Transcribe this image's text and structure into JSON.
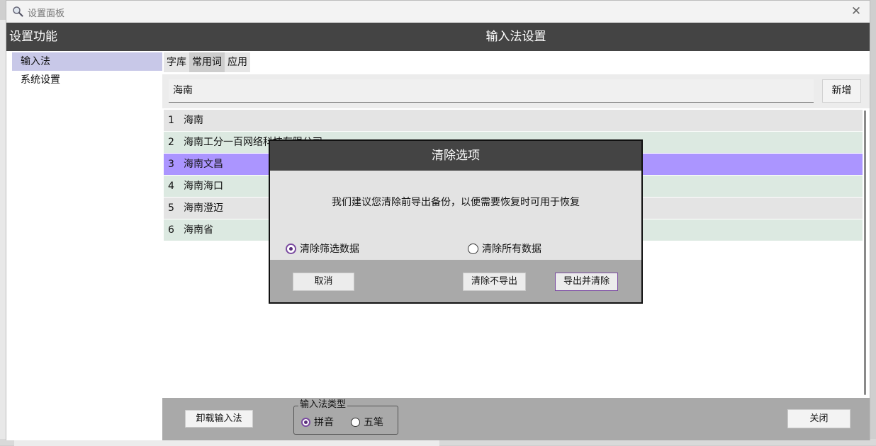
{
  "window": {
    "title": "设置面板"
  },
  "sidebar": {
    "header": "设置功能",
    "items": [
      {
        "label": "输入法"
      },
      {
        "label": "系统设置"
      }
    ]
  },
  "main": {
    "header": "输入法设置",
    "tabs": [
      {
        "label": "字库"
      },
      {
        "label": "常用词"
      },
      {
        "label": "应用"
      }
    ],
    "search": {
      "value": "海南"
    },
    "add_button": "新增",
    "rows": [
      {
        "num": "1",
        "text": "海南"
      },
      {
        "num": "2",
        "text": "海南工分一百网络科技有限公司"
      },
      {
        "num": "3",
        "text": "海南文昌"
      },
      {
        "num": "4",
        "text": "海南海口"
      },
      {
        "num": "5",
        "text": "海南澄迈"
      },
      {
        "num": "6",
        "text": "海南省"
      }
    ]
  },
  "bottom": {
    "uninstall_button": "卸载输入法",
    "type_group_label": "输入法类型",
    "option_pinyin": "拼音",
    "option_wubi": "五笔",
    "close_button": "关闭"
  },
  "dialog": {
    "title": "清除选项",
    "message": "我们建议您清除前导出备份，以便需要恢复时可用于恢复",
    "option_filtered": "清除筛选数据",
    "option_all": "清除所有数据",
    "cancel_button": "取消",
    "clear_no_export_button": "清除不导出",
    "export_and_clear_button": "导出并清除"
  }
}
